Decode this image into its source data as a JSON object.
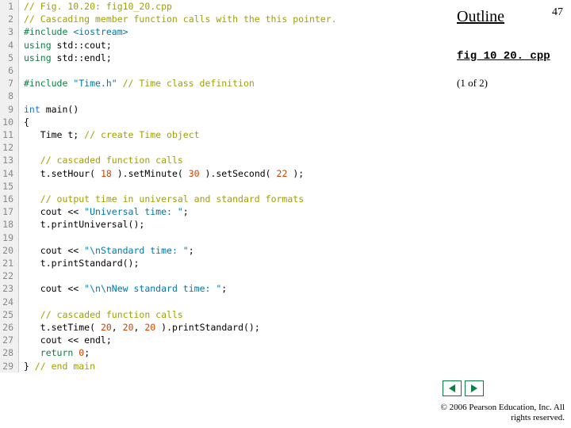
{
  "side": {
    "outline": "Outline",
    "page_number": "47",
    "filename": "fig 10_20. cpp",
    "part": "(1 of 2)"
  },
  "copyright": "© 2006 Pearson Education, Inc. All rights reserved.",
  "code": {
    "lines": [
      {
        "n": 1,
        "spans": [
          {
            "cls": "cm",
            "t": "// Fig. 10.20: fig10_20.cpp"
          }
        ]
      },
      {
        "n": 2,
        "spans": [
          {
            "cls": "cm",
            "t": "// Cascading member function calls with the this pointer."
          }
        ]
      },
      {
        "n": 3,
        "spans": [
          {
            "cls": "pp",
            "t": "#include "
          },
          {
            "cls": "str",
            "t": "<iostream>"
          }
        ]
      },
      {
        "n": 4,
        "spans": [
          {
            "cls": "kw",
            "t": "using "
          },
          {
            "cls": "black",
            "t": "std::cout;"
          }
        ]
      },
      {
        "n": 5,
        "spans": [
          {
            "cls": "kw",
            "t": "using "
          },
          {
            "cls": "black",
            "t": "std::endl;"
          }
        ]
      },
      {
        "n": 6,
        "spans": [
          {
            "cls": "",
            "t": ""
          }
        ]
      },
      {
        "n": 7,
        "spans": [
          {
            "cls": "pp",
            "t": "#include "
          },
          {
            "cls": "str",
            "t": "\"Time.h\""
          },
          {
            "cls": "cm",
            "t": " // Time class definition"
          }
        ]
      },
      {
        "n": 8,
        "spans": [
          {
            "cls": "",
            "t": ""
          }
        ]
      },
      {
        "n": 9,
        "spans": [
          {
            "cls": "ty",
            "t": "int "
          },
          {
            "cls": "black",
            "t": "main()"
          }
        ]
      },
      {
        "n": 10,
        "spans": [
          {
            "cls": "black",
            "t": "{"
          }
        ]
      },
      {
        "n": 11,
        "spans": [
          {
            "cls": "black",
            "t": "   Time t; "
          },
          {
            "cls": "cm",
            "t": "// create Time object"
          }
        ]
      },
      {
        "n": 12,
        "spans": [
          {
            "cls": "",
            "t": ""
          }
        ]
      },
      {
        "n": 13,
        "spans": [
          {
            "cls": "black",
            "t": "   "
          },
          {
            "cls": "cm",
            "t": "// cascaded function calls"
          }
        ]
      },
      {
        "n": 14,
        "spans": [
          {
            "cls": "black",
            "t": "   t.setHour( "
          },
          {
            "cls": "num",
            "t": "18"
          },
          {
            "cls": "black",
            "t": " ).setMinute( "
          },
          {
            "cls": "num",
            "t": "30"
          },
          {
            "cls": "black",
            "t": " ).setSecond( "
          },
          {
            "cls": "num",
            "t": "22"
          },
          {
            "cls": "black",
            "t": " );"
          }
        ]
      },
      {
        "n": 15,
        "spans": [
          {
            "cls": "",
            "t": ""
          }
        ]
      },
      {
        "n": 16,
        "spans": [
          {
            "cls": "black",
            "t": "   "
          },
          {
            "cls": "cm",
            "t": "// output time in universal and standard formats"
          }
        ]
      },
      {
        "n": 17,
        "spans": [
          {
            "cls": "black",
            "t": "   cout << "
          },
          {
            "cls": "str",
            "t": "\"Universal time: \""
          },
          {
            "cls": "black",
            "t": ";"
          }
        ]
      },
      {
        "n": 18,
        "spans": [
          {
            "cls": "black",
            "t": "   t.printUniversal();"
          }
        ]
      },
      {
        "n": 19,
        "spans": [
          {
            "cls": "",
            "t": ""
          }
        ]
      },
      {
        "n": 20,
        "spans": [
          {
            "cls": "black",
            "t": "   cout << "
          },
          {
            "cls": "str",
            "t": "\"\\nStandard time: \""
          },
          {
            "cls": "black",
            "t": ";"
          }
        ]
      },
      {
        "n": 21,
        "spans": [
          {
            "cls": "black",
            "t": "   t.printStandard();"
          }
        ]
      },
      {
        "n": 22,
        "spans": [
          {
            "cls": "",
            "t": ""
          }
        ]
      },
      {
        "n": 23,
        "spans": [
          {
            "cls": "black",
            "t": "   cout << "
          },
          {
            "cls": "str",
            "t": "\"\\n\\nNew standard time: \""
          },
          {
            "cls": "black",
            "t": ";"
          }
        ]
      },
      {
        "n": 24,
        "spans": [
          {
            "cls": "",
            "t": ""
          }
        ]
      },
      {
        "n": 25,
        "spans": [
          {
            "cls": "black",
            "t": "   "
          },
          {
            "cls": "cm",
            "t": "// cascaded function calls"
          }
        ]
      },
      {
        "n": 26,
        "spans": [
          {
            "cls": "black",
            "t": "   t.setTime( "
          },
          {
            "cls": "num",
            "t": "20"
          },
          {
            "cls": "black",
            "t": ", "
          },
          {
            "cls": "num",
            "t": "20"
          },
          {
            "cls": "black",
            "t": ", "
          },
          {
            "cls": "num",
            "t": "20"
          },
          {
            "cls": "black",
            "t": " ).printStandard();"
          }
        ]
      },
      {
        "n": 27,
        "spans": [
          {
            "cls": "black",
            "t": "   cout << endl;"
          }
        ]
      },
      {
        "n": 28,
        "spans": [
          {
            "cls": "black",
            "t": "   "
          },
          {
            "cls": "kw",
            "t": "return "
          },
          {
            "cls": "num",
            "t": "0"
          },
          {
            "cls": "black",
            "t": ";"
          }
        ]
      },
      {
        "n": 29,
        "spans": [
          {
            "cls": "black",
            "t": "} "
          },
          {
            "cls": "cm",
            "t": "// end main"
          }
        ]
      }
    ]
  }
}
